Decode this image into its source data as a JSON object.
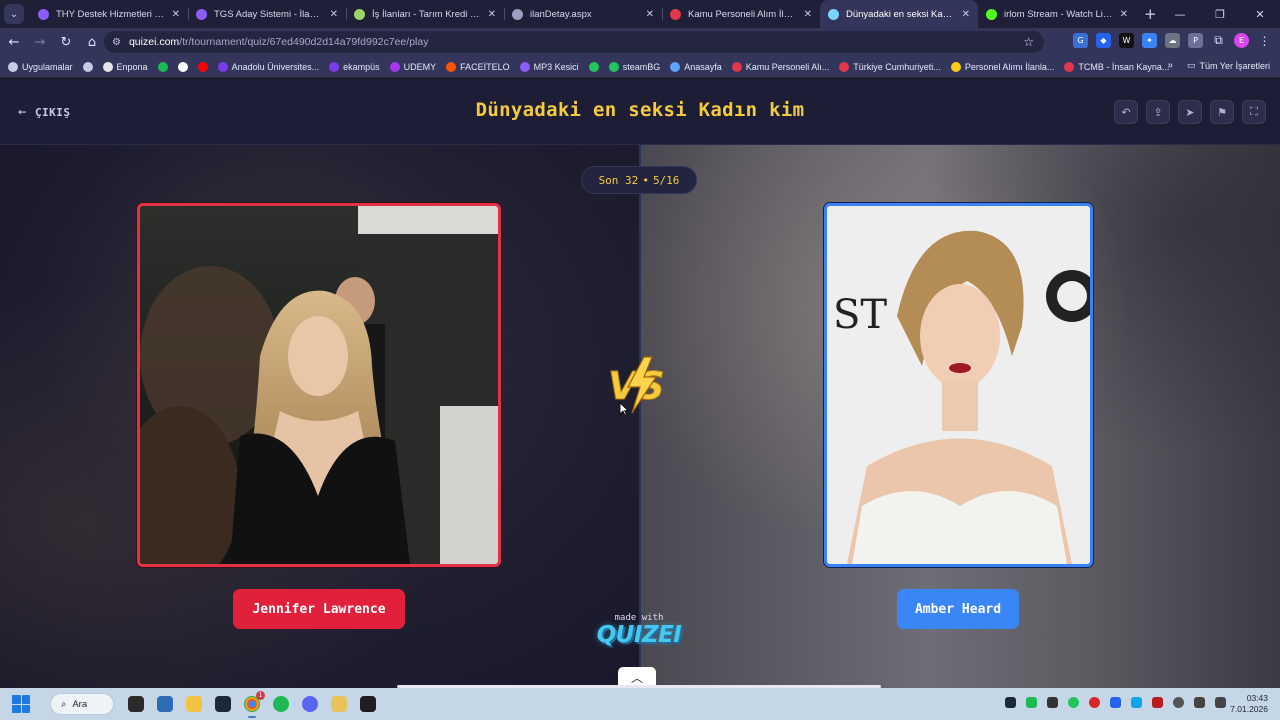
{
  "browser": {
    "tabs": [
      {
        "title": "THY Destek Hizmetleri İş İlanları",
        "favicon_color": "#8b5cf6",
        "active": false
      },
      {
        "title": "TGS Aday Sistemi - İlan Listesi",
        "favicon_color": "#8b5cf6",
        "active": false
      },
      {
        "title": "İş İlanları - Tarım Kredi Holding",
        "favicon_color": "#9bd46b",
        "active": false
      },
      {
        "title": "ilanDetay.aspx",
        "favicon_color": "#9aa0c0",
        "active": false
      },
      {
        "title": "Kamu Personeli Alım İlanları",
        "favicon_color": "#e0384a",
        "active": false
      },
      {
        "title": "Dünyadaki en seksi Kadın kim",
        "favicon_color": "#7dd3fc",
        "active": true
      },
      {
        "title": "irlom Stream - Watch Live on K",
        "favicon_color": "#53fc18",
        "active": false
      }
    ],
    "url_host": "quizei.com",
    "url_path": "/tr/tournament/quiz/67ed490d2d14a79fd992c7ee/play",
    "bookmarks": [
      {
        "label": "Uygulamalar",
        "color": "#c8cbe6"
      },
      {
        "label": "",
        "color": "#c8cbe6"
      },
      {
        "label": "Enpona",
        "color": "#e6e6e6"
      },
      {
        "label": "",
        "color": "#1db954"
      },
      {
        "label": "",
        "color": "#ffffff"
      },
      {
        "label": "",
        "color": "#ff0000"
      },
      {
        "label": "Anadolu Üniversites...",
        "color": "#7c3aed"
      },
      {
        "label": "ekampüs",
        "color": "#7c3aed"
      },
      {
        "label": "UDEMY",
        "color": "#a435f0"
      },
      {
        "label": "FACEİTELO",
        "color": "#ff5500"
      },
      {
        "label": "MP3 Kesici",
        "color": "#8b5cf6"
      },
      {
        "label": "",
        "color": "#22c55e"
      },
      {
        "label": "steamBG",
        "color": "#22c55e"
      },
      {
        "label": "Anasayfa",
        "color": "#60a5fa"
      },
      {
        "label": "Kamu Personeli Alı...",
        "color": "#e0384a"
      },
      {
        "label": "Türkiye Cumhuriyeti...",
        "color": "#e0384a"
      },
      {
        "label": "Personel Alımı İlanla...",
        "color": "#facc15"
      },
      {
        "label": "TCMB - İnsan Kayna...",
        "color": "#e0384a"
      }
    ],
    "all_bookmarks": "Tüm Yer İşaretleri"
  },
  "quiz": {
    "exit_label": "ÇIKIŞ",
    "title": "Dünyadaki en seksi Kadın kim",
    "round": "Son 32",
    "separator": "•",
    "progress": "5/16",
    "vs_label": "VS",
    "left": {
      "name": "Jennifer Lawrence",
      "accent": "#e1213b"
    },
    "right": {
      "name": "Amber Heard",
      "accent": "#3b86f7"
    },
    "made_with": "made with",
    "brand": "QUIZEI"
  },
  "taskbar": {
    "search_label": "Ara",
    "time": "03:43",
    "date": "7.01.2026",
    "badge_count": "1"
  }
}
